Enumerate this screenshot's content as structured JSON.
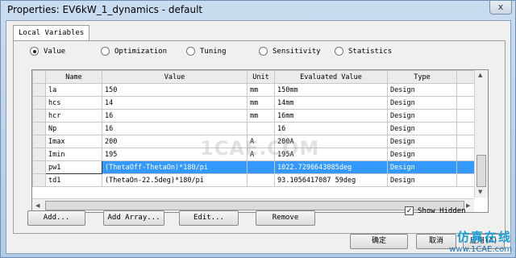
{
  "window": {
    "title": "Properties: EV6kW_1_dynamics - default",
    "close_label": "x"
  },
  "tabs": [
    {
      "label": "Local Variables"
    }
  ],
  "modes": [
    {
      "label": "Value",
      "selected": true
    },
    {
      "label": "Optimization",
      "selected": false
    },
    {
      "label": "Tuning",
      "selected": false
    },
    {
      "label": "Sensitivity",
      "selected": false
    },
    {
      "label": "Statistics",
      "selected": false
    }
  ],
  "table": {
    "columns": [
      "Name",
      "Value",
      "Unit",
      "Evaluated Value",
      "Type"
    ],
    "rows": [
      {
        "name": "la",
        "value": "150",
        "unit": "mm",
        "evaluated": "150mm",
        "type": "Design"
      },
      {
        "name": "hcs",
        "value": "14",
        "unit": "mm",
        "evaluated": "14mm",
        "type": "Design"
      },
      {
        "name": "hcr",
        "value": "16",
        "unit": "mm",
        "evaluated": "16mm",
        "type": "Design"
      },
      {
        "name": "Np",
        "value": "16",
        "unit": "",
        "evaluated": "16",
        "type": "Design"
      },
      {
        "name": "Imax",
        "value": "200",
        "unit": "A",
        "evaluated": "200A",
        "type": "Design"
      },
      {
        "name": "Imin",
        "value": "195",
        "unit": "A",
        "evaluated": "195A",
        "type": "Design"
      },
      {
        "name": "pw1",
        "value": "(ThetaOff-ThetaOn)*180/pi",
        "unit": "",
        "evaluated": "1022.7296643085deg",
        "type": "Design"
      },
      {
        "name": "td1",
        "value": "(ThetaOn-22.5deg)*180/pi",
        "unit": "",
        "evaluated": "93.1056417087 59deg",
        "type": "Design"
      }
    ]
  },
  "buttons": {
    "add": "Add...",
    "add_array": "Add Array...",
    "edit": "Edit...",
    "remove": "Remove",
    "ok": "确定",
    "cancel": "取消",
    "apply": "应用(A)"
  },
  "show_hidden": {
    "label": "Show Hidden",
    "checked": true
  },
  "watermark": "1CAE.COM",
  "brand": {
    "cn": "仿真在线",
    "en": "www.1CAE.com"
  }
}
